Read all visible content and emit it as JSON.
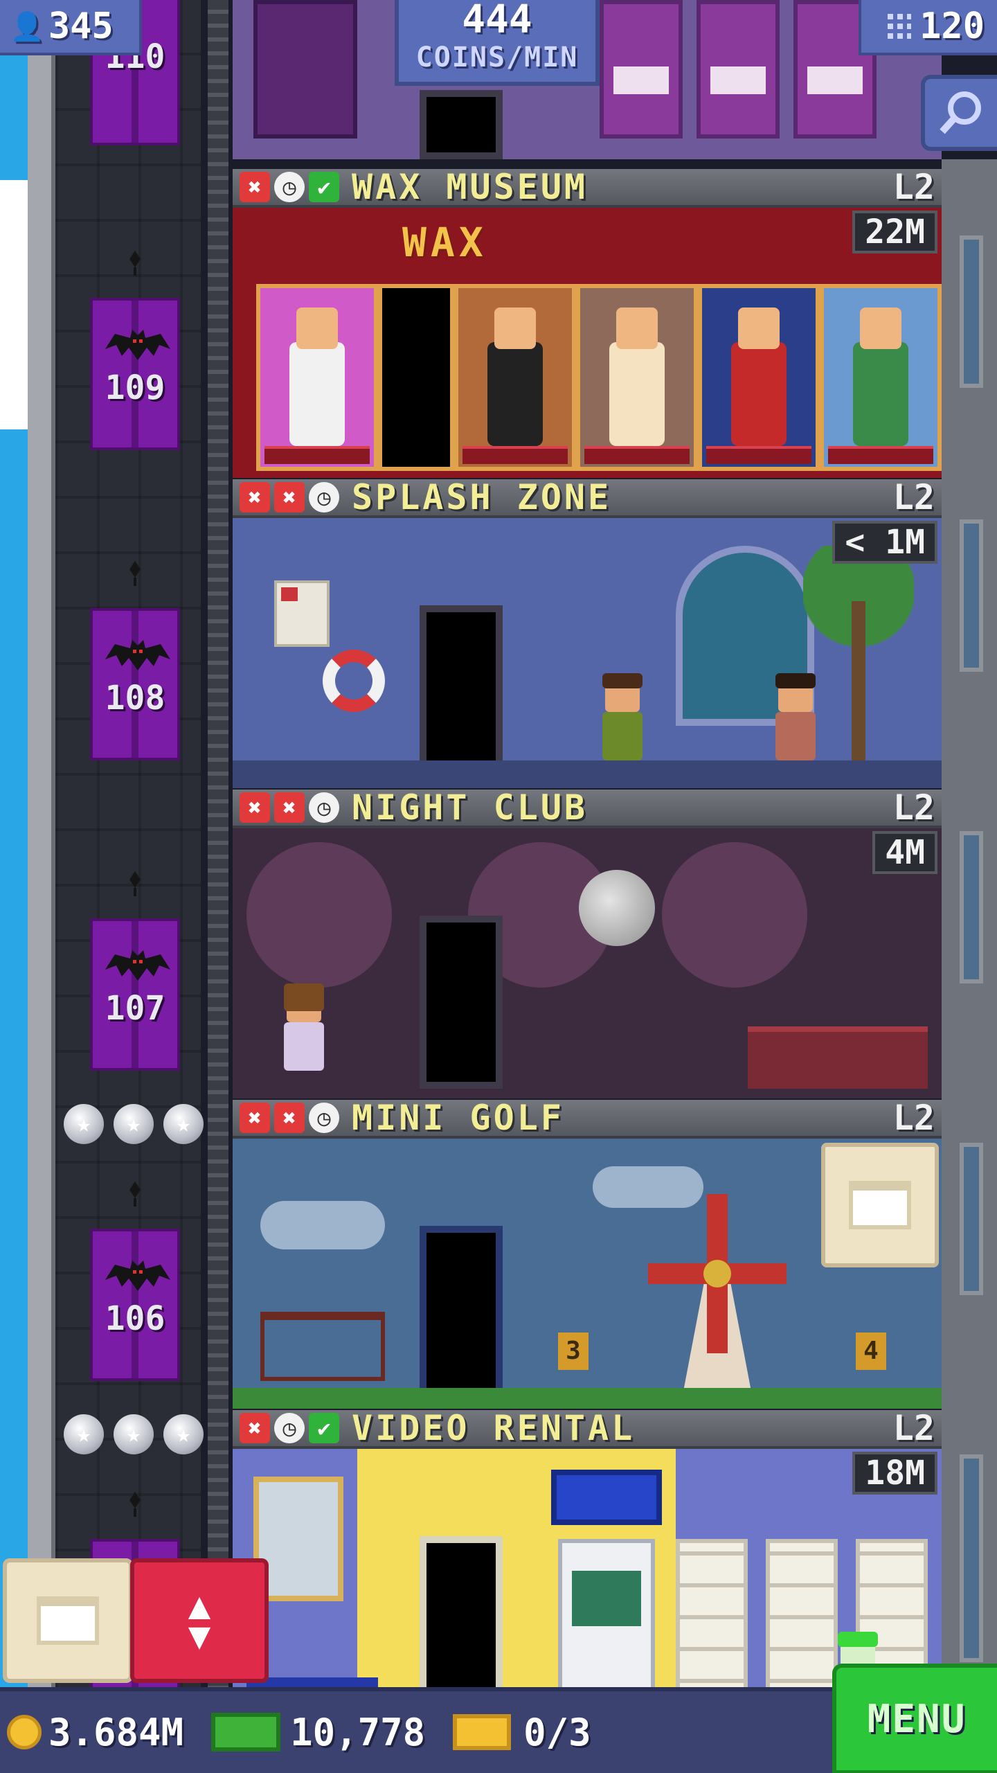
{
  "hud": {
    "population": "345",
    "coins_per_min_value": "444",
    "coins_per_min_label": "COINS/MIN",
    "floor_count": "120"
  },
  "elevator": {
    "floors": [
      {
        "number": "110"
      },
      {
        "number": "109"
      },
      {
        "number": "108"
      },
      {
        "number": "107"
      },
      {
        "number": "106"
      }
    ]
  },
  "floors": [
    {
      "name": "WAX MUSEUM",
      "level": "L2",
      "timer": "22M",
      "status": [
        "x",
        "clock",
        "check"
      ],
      "wax_sign": "WAX"
    },
    {
      "name": "SPLASH ZONE",
      "level": "L2",
      "timer": "< 1M",
      "status": [
        "x",
        "x",
        "clock"
      ]
    },
    {
      "name": "NIGHT CLUB",
      "level": "L2",
      "timer": "4M",
      "status": [
        "x",
        "x",
        "clock"
      ]
    },
    {
      "name": "MINI GOLF",
      "level": "L2",
      "timer": "",
      "status": [
        "x",
        "x",
        "clock"
      ],
      "holes": [
        "3",
        "4"
      ]
    },
    {
      "name": "VIDEO RENTAL",
      "level": "L2",
      "timer": "18M",
      "status": [
        "x",
        "clock",
        "check"
      ]
    }
  ],
  "bottom_bar": {
    "coins": "3.684M",
    "bux": "10,778",
    "tickets": "0/3",
    "menu_label": "MENU"
  },
  "icons": {
    "status_x": "✖",
    "status_clock": "◷",
    "status_check": "✔",
    "star": "★",
    "elevator_arrows_up": "▲",
    "elevator_arrows_down": "▼",
    "population_icon": "👤"
  },
  "colors": {
    "floor_name": "#f3ee96",
    "elevator_purple": "#7a1ca5",
    "hud_blue": "#5a6db8",
    "menu_green": "#2cc63a",
    "elevator_button_red": "#e02a4a"
  }
}
